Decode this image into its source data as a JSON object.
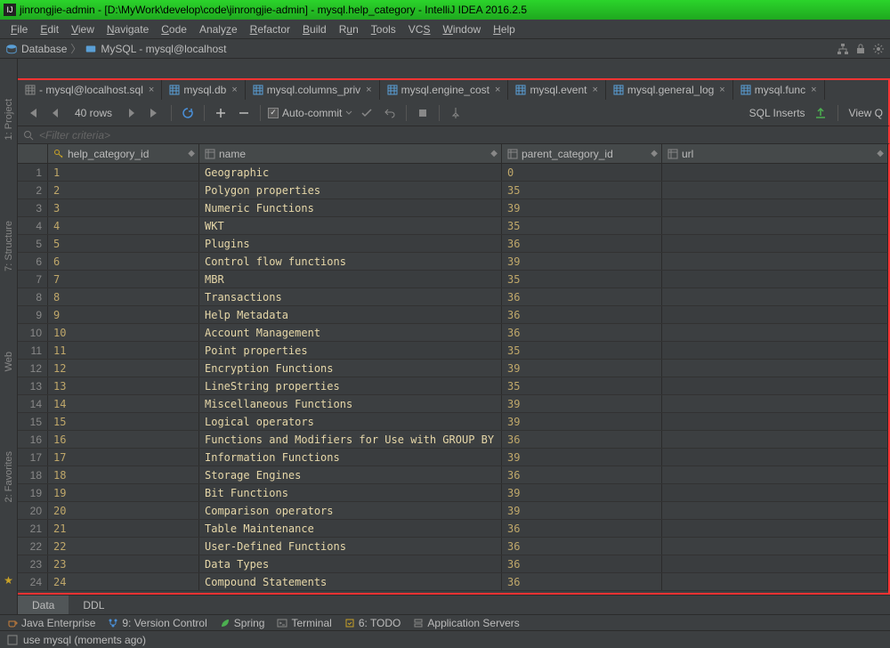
{
  "window": {
    "title": "jinrongjie-admin - [D:\\MyWork\\develop\\code\\jinrongjie-admin] - mysql.help_category - IntelliJ IDEA 2016.2.5"
  },
  "menu": {
    "items": [
      "File",
      "Edit",
      "View",
      "Navigate",
      "Code",
      "Analyze",
      "Refactor",
      "Build",
      "Run",
      "Tools",
      "VCS",
      "Window",
      "Help"
    ]
  },
  "breadcrumb": {
    "items": [
      "Database",
      "MySQL - mysql@localhost"
    ]
  },
  "editor_tabs": [
    {
      "label": "mysql@localhost.sql",
      "kind": "file",
      "active": false,
      "prefix": "- "
    },
    {
      "label": "mysql.db",
      "kind": "table",
      "active": false,
      "prefix": ""
    },
    {
      "label": "mysql.columns_priv",
      "kind": "table",
      "active": false,
      "prefix": ""
    },
    {
      "label": "mysql.engine_cost",
      "kind": "table",
      "active": false,
      "prefix": ""
    },
    {
      "label": "mysql.event",
      "kind": "table",
      "active": false,
      "prefix": ""
    },
    {
      "label": "mysql.general_log",
      "kind": "table",
      "active": false,
      "prefix": ""
    },
    {
      "label": "mysql.func",
      "kind": "table",
      "active": false,
      "prefix": ""
    }
  ],
  "toolbar": {
    "row_count": "40 rows",
    "auto_commit": "Auto-commit",
    "sql_inserts": "SQL Inserts",
    "view_query": "View Q"
  },
  "filter": {
    "placeholder": "<Filter criteria>"
  },
  "columns": [
    {
      "name": "help_category_id",
      "icon": "key"
    },
    {
      "name": "name",
      "icon": "column"
    },
    {
      "name": "parent_category_id",
      "icon": "column"
    },
    {
      "name": "url",
      "icon": "column"
    }
  ],
  "rows": [
    {
      "n": 1,
      "id": "1",
      "name": "Geographic",
      "parent": "0",
      "url": ""
    },
    {
      "n": 2,
      "id": "2",
      "name": "Polygon properties",
      "parent": "35",
      "url": ""
    },
    {
      "n": 3,
      "id": "3",
      "name": "Numeric Functions",
      "parent": "39",
      "url": ""
    },
    {
      "n": 4,
      "id": "4",
      "name": "WKT",
      "parent": "35",
      "url": ""
    },
    {
      "n": 5,
      "id": "5",
      "name": "Plugins",
      "parent": "36",
      "url": ""
    },
    {
      "n": 6,
      "id": "6",
      "name": "Control flow functions",
      "parent": "39",
      "url": ""
    },
    {
      "n": 7,
      "id": "7",
      "name": "MBR",
      "parent": "35",
      "url": ""
    },
    {
      "n": 8,
      "id": "8",
      "name": "Transactions",
      "parent": "36",
      "url": ""
    },
    {
      "n": 9,
      "id": "9",
      "name": "Help Metadata",
      "parent": "36",
      "url": ""
    },
    {
      "n": 10,
      "id": "10",
      "name": "Account Management",
      "parent": "36",
      "url": ""
    },
    {
      "n": 11,
      "id": "11",
      "name": "Point properties",
      "parent": "35",
      "url": ""
    },
    {
      "n": 12,
      "id": "12",
      "name": "Encryption Functions",
      "parent": "39",
      "url": ""
    },
    {
      "n": 13,
      "id": "13",
      "name": "LineString properties",
      "parent": "35",
      "url": ""
    },
    {
      "n": 14,
      "id": "14",
      "name": "Miscellaneous Functions",
      "parent": "39",
      "url": ""
    },
    {
      "n": 15,
      "id": "15",
      "name": "Logical operators",
      "parent": "39",
      "url": ""
    },
    {
      "n": 16,
      "id": "16",
      "name": "Functions and Modifiers for Use with GROUP BY",
      "parent": "36",
      "url": ""
    },
    {
      "n": 17,
      "id": "17",
      "name": "Information Functions",
      "parent": "39",
      "url": ""
    },
    {
      "n": 18,
      "id": "18",
      "name": "Storage Engines",
      "parent": "36",
      "url": ""
    },
    {
      "n": 19,
      "id": "19",
      "name": "Bit Functions",
      "parent": "39",
      "url": ""
    },
    {
      "n": 20,
      "id": "20",
      "name": "Comparison operators",
      "parent": "39",
      "url": ""
    },
    {
      "n": 21,
      "id": "21",
      "name": "Table Maintenance",
      "parent": "36",
      "url": ""
    },
    {
      "n": 22,
      "id": "22",
      "name": "User-Defined Functions",
      "parent": "36",
      "url": ""
    },
    {
      "n": 23,
      "id": "23",
      "name": "Data Types",
      "parent": "36",
      "url": ""
    },
    {
      "n": 24,
      "id": "24",
      "name": "Compound Statements",
      "parent": "36",
      "url": ""
    }
  ],
  "bottom_tabs": {
    "data": "Data",
    "ddl": "DDL"
  },
  "side_labels": {
    "project": "1: Project",
    "structure": "7: Structure",
    "web": "Web",
    "favorites": "2: Favorites"
  },
  "toolwindows": [
    {
      "label": "Java Enterprise",
      "icon": "coffee"
    },
    {
      "label": "9: Version Control",
      "icon": "branch"
    },
    {
      "label": "Spring",
      "icon": "leaf"
    },
    {
      "label": "Terminal",
      "icon": "terminal"
    },
    {
      "label": "6: TODO",
      "icon": "todo"
    },
    {
      "label": "Application Servers",
      "icon": "server"
    }
  ],
  "status": {
    "message": "use mysql (moments ago)"
  }
}
